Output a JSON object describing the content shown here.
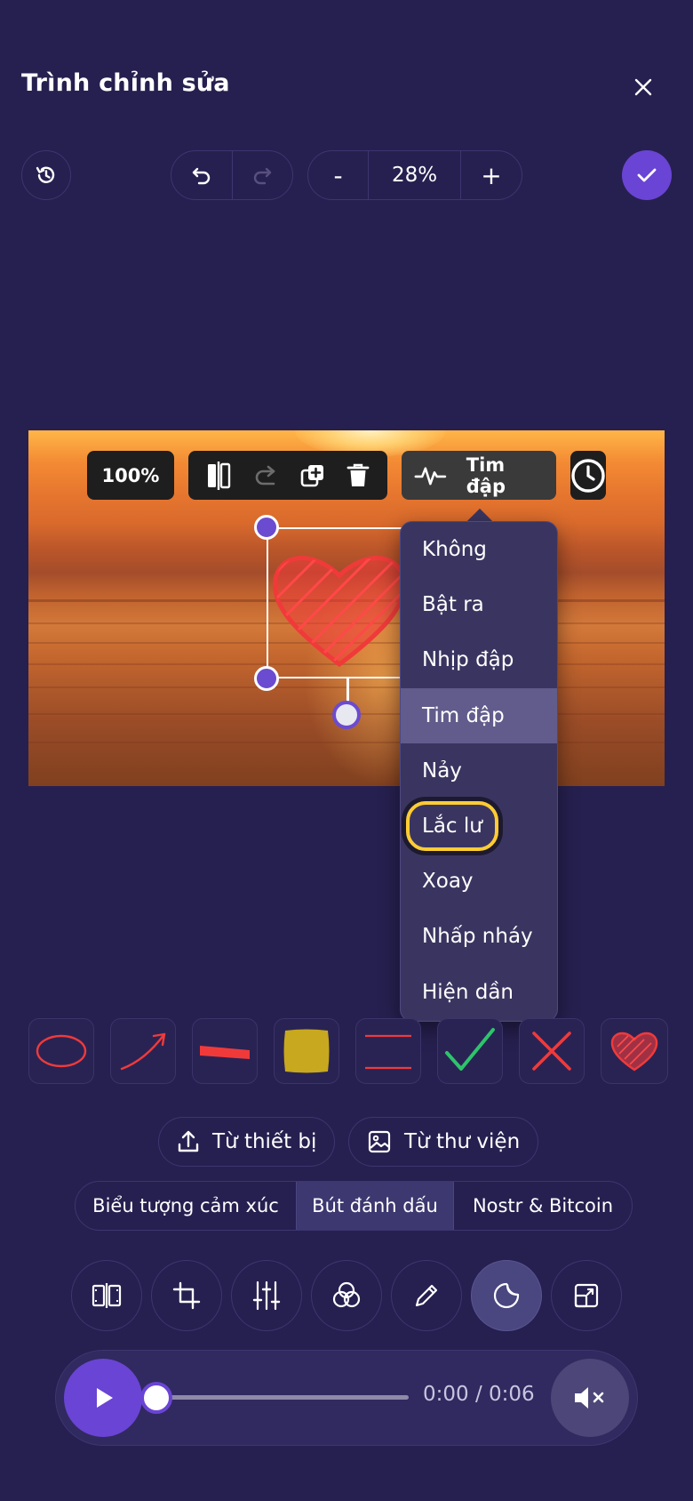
{
  "header": {
    "title": "Trình chỉnh sửa",
    "close_icon": "close-icon"
  },
  "toolbar": {
    "history_icon": "history-icon",
    "undo_icon": "undo-icon",
    "redo_icon": "redo-icon",
    "zoom_out_label": "-",
    "zoom_value": "28%",
    "zoom_in_label": "+",
    "confirm_icon": "check-icon"
  },
  "context_toolbar": {
    "opacity": "100%",
    "tools": [
      "flip-icon",
      "redo-arrow-icon",
      "duplicate-icon",
      "trash-icon"
    ],
    "animation_icon": "pulse-icon",
    "animation_label": "Tim đập",
    "timing_icon": "clock-icon"
  },
  "animation_menu": {
    "items": [
      "Không",
      "Bật ra",
      "Nhịp đập",
      "Tim đập",
      "Nảy",
      "Lắc lư",
      "Xoay",
      "Nhấp nháy",
      "Hiện dần"
    ],
    "selected": "Tim đập",
    "focused": "Lắc lư"
  },
  "stickers": [
    "ellipse-sticker",
    "arrow-sticker",
    "line-sticker",
    "highlight-sticker",
    "double-line-sticker",
    "check-sticker",
    "cross-sticker",
    "heart-sticker"
  ],
  "upload": {
    "from_device": "Từ thiết bị",
    "from_library": "Từ thư viện"
  },
  "tabs": [
    {
      "label": "Biểu tượng cảm xúc",
      "active": false
    },
    {
      "label": "Bút đánh dấu",
      "active": true
    },
    {
      "label": "Nostr & Bitcoin",
      "active": false
    }
  ],
  "tools": [
    "trim-icon",
    "crop-icon",
    "adjust-icon",
    "filter-icon",
    "draw-icon",
    "sticker-icon",
    "resize-icon"
  ],
  "active_tool": "sticker-icon",
  "player": {
    "time": "0:00 / 0:06",
    "progress": 0,
    "muted": true
  },
  "colors": {
    "background": "#262050",
    "accent": "#6a44d4",
    "sticker_red": "#f03a3a",
    "highlight_yellow": "#ffcc33"
  }
}
